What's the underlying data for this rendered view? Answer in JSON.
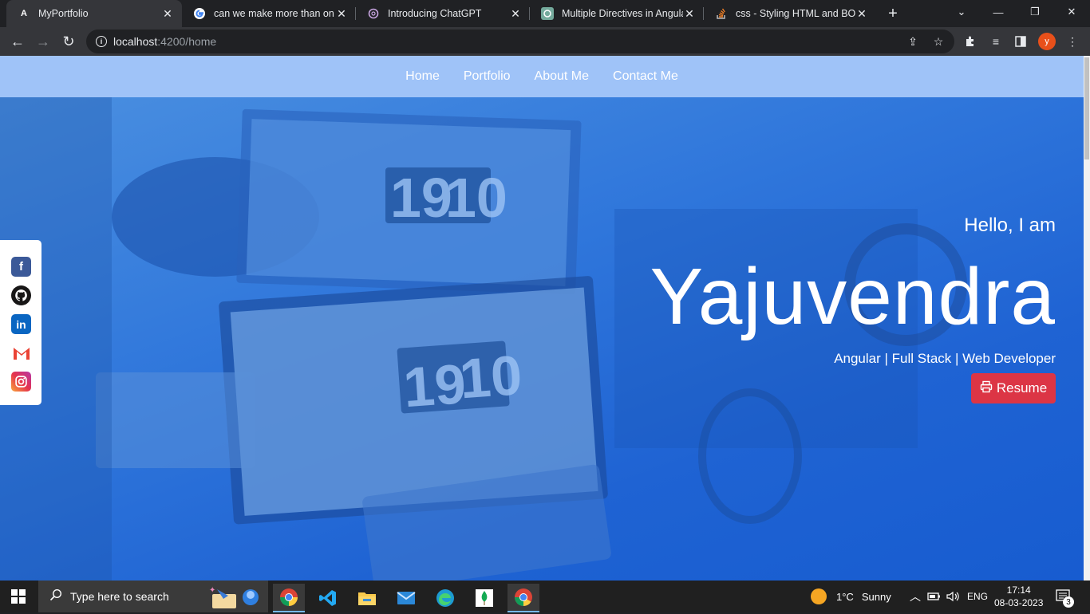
{
  "browser": {
    "tabs": [
      {
        "title": "MyPortfolio",
        "active": true,
        "favicon": "angular-logo-icon"
      },
      {
        "title": "can we make more than on d",
        "active": false,
        "favicon": "google-logo-icon"
      },
      {
        "title": "Introducing ChatGPT",
        "active": false,
        "favicon": "openai-logo-icon"
      },
      {
        "title": "Multiple Directives in Angula",
        "active": false,
        "favicon": "chatgpt-logo-icon"
      },
      {
        "title": "css - Styling HTML and BODY",
        "active": false,
        "favicon": "stackoverflow-logo-icon"
      }
    ],
    "url_host": "localhost",
    "url_rest": ":4200/home",
    "profile_initial": "y"
  },
  "nav": {
    "items": [
      "Home",
      "Portfolio",
      "About Me",
      "Contact Me"
    ]
  },
  "hero": {
    "greeting": "Hello, I am",
    "name": "Yajuvendra",
    "tagline": "Angular | Full Stack | Web Developer",
    "resume_label": "Resume"
  },
  "social": [
    "facebook-icon",
    "github-icon",
    "linkedin-icon",
    "gmail-icon",
    "instagram-icon"
  ],
  "taskbar": {
    "search_placeholder": "Type here to search",
    "weather_temp": "1°C",
    "weather_text": "Sunny",
    "lang": "ENG",
    "time": "17:14",
    "date": "08-03-2023",
    "notif_count": "3"
  },
  "colors": {
    "nav_bg": "#9fc3f8",
    "hero_blue": "#1f63d3",
    "resume_red": "#dc3545"
  }
}
